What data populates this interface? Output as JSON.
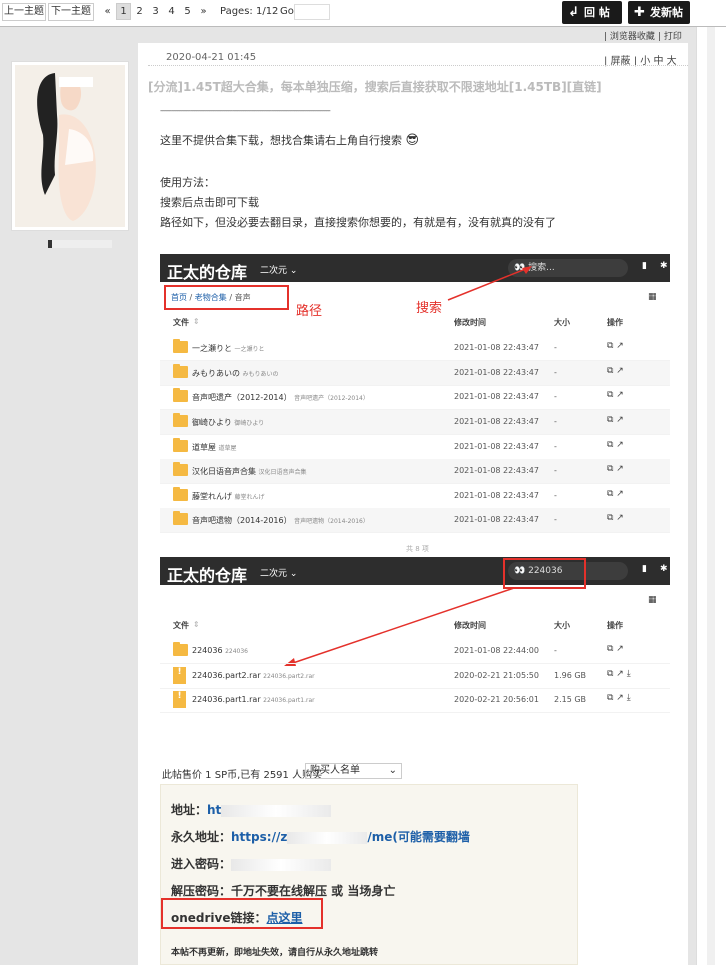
{
  "topnav": {
    "prev_topic": "上一主题",
    "next_topic": "下一主题",
    "pages": [
      "«",
      "1",
      "2",
      "3",
      "4",
      "5",
      "»"
    ],
    "current_page": "1",
    "pages_info": "Pages: 1/12",
    "go_label": "Go",
    "reply_button": "回 帖",
    "new_post_button": "发新帖"
  },
  "toolbar": {
    "bookmark": "| 浏览器收藏",
    "print": "| 打印"
  },
  "post": {
    "date": "2020-04-21 01:45",
    "controls": "| 屏蔽 | 小 中 大",
    "title": "[分流]1.45T超大合集，每本单独压缩，搜索后直接获取不限速地址[1.45TB][直链]",
    "divider": "------------------------------------------------------------------------------------------",
    "line1": "这里不提供合集下载，想找合集请右上角自行搜索",
    "usage_title": "使用方法：",
    "usage_1": "搜索后点击即可下载",
    "usage_2": "路径如下，但没必要去翻目录，直接搜索你想要的，有就是有，没有就真的没有了"
  },
  "screenshot1": {
    "title": "正太的仓库",
    "category": "二次元",
    "search_placeholder": "搜索...",
    "breadcrumb": [
      "首页",
      "/",
      "老物合集",
      "/",
      "音声"
    ],
    "annot_path": "路径",
    "annot_search": "搜索",
    "columns": [
      "文件",
      "修改时间",
      "大小",
      "操作"
    ],
    "rows": [
      {
        "name": "一之瀬りと",
        "sub": "一之瀬りと",
        "date": "2021-01-08 22:43:47",
        "size": "-"
      },
      {
        "name": "みもりあいの",
        "sub": "みもりあいの",
        "date": "2021-01-08 22:43:47",
        "size": "-"
      },
      {
        "name": "音声吧遗产（2012-2014）",
        "sub": "音声吧遗产（2012-2014）",
        "date": "2021-01-08 22:43:47",
        "size": "-"
      },
      {
        "name": "御崎ひより",
        "sub": "御崎ひより",
        "date": "2021-01-08 22:43:47",
        "size": "-"
      },
      {
        "name": "道草屋",
        "sub": "道草屋",
        "date": "2021-01-08 22:43:47",
        "size": "-"
      },
      {
        "name": "汉化日语音声合集",
        "sub": "汉化日语音声合集",
        "date": "2021-01-08 22:43:47",
        "size": "-"
      },
      {
        "name": "藤堂れんげ",
        "sub": "藤堂れんげ",
        "date": "2021-01-08 22:43:47",
        "size": "-"
      },
      {
        "name": "音声吧遗物（2014-2016）",
        "sub": "音声吧遗物（2014-2016）",
        "date": "2021-01-08 22:43:47",
        "size": "-"
      }
    ],
    "footer": "共 8 项"
  },
  "screenshot2": {
    "title": "正太的仓库",
    "category": "二次元",
    "search_value": "224036",
    "columns": [
      "文件",
      "修改时间",
      "大小",
      "操作"
    ],
    "rows": [
      {
        "name": "224036",
        "sub": "224036",
        "date": "2021-01-08 22:44:00",
        "size": "-"
      },
      {
        "name": "224036.part2.rar",
        "sub": "224036.part2.rar",
        "date": "2020-02-21 21:05:50",
        "size": "1.96 GB"
      },
      {
        "name": "224036.part1.rar",
        "sub": "224036.part1.rar",
        "date": "2020-02-21 20:56:01",
        "size": "2.15 GB"
      }
    ]
  },
  "sale": {
    "text": "此帖售价 1 SP币,已有 2591 人购买",
    "buyers_select": "购买人名单"
  },
  "info": {
    "address_label": "地址：",
    "address_value": "ht",
    "perm_label": "永久地址：",
    "perm_value_start": "https://z",
    "perm_value_end": "/me(可能需要翻墙",
    "password_label": "进入密码：",
    "unzip_label": "解压密码：千万不要在线解压  或  当场身亡",
    "onedrive_label": "onedrive链接：",
    "onedrive_link": "点这里",
    "notice": "本帖不再更新，即地址失效，请自行从永久地址跳转"
  },
  "colors": {
    "accent_red": "#e4312b",
    "panel_dark": "#2d2d2d",
    "link_blue": "#1d5fa8"
  }
}
